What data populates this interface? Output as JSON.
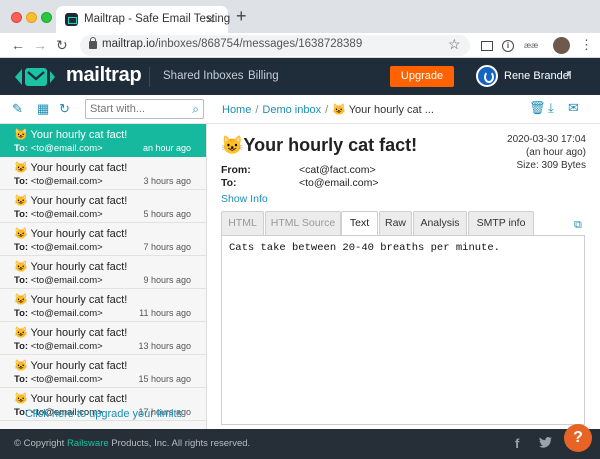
{
  "browser": {
    "tab_title": "Mailtrap - Safe Email Testing",
    "tab_close": "×",
    "new_tab": "+",
    "url_host": "mailtrap.io",
    "url_path": "/inboxes/868754/messages/1638728389",
    "translate_label": "ææ"
  },
  "header": {
    "logo": "mailtrap",
    "nav": [
      "Shared Inboxes",
      "Billing"
    ],
    "upgrade_label": "Upgrade",
    "user_name": "Rene Brandel"
  },
  "subbar": {
    "search_placeholder": "Start with...",
    "breadcrumb": [
      "Home",
      "Demo inbox",
      "😺 Your hourly cat ..."
    ]
  },
  "messages": [
    {
      "subject": "😺 Your hourly cat fact!",
      "to_label": "To:",
      "to": "<to@email.com>",
      "time": "an hour ago",
      "active": true
    },
    {
      "subject": "😺 Your hourly cat fact!",
      "to_label": "To:",
      "to": "<to@email.com>",
      "time": "3 hours ago"
    },
    {
      "subject": "😺 Your hourly cat fact!",
      "to_label": "To:",
      "to": "<to@email.com>",
      "time": "5 hours ago"
    },
    {
      "subject": "😺 Your hourly cat fact!",
      "to_label": "To:",
      "to": "<to@email.com>",
      "time": "7 hours ago"
    },
    {
      "subject": "😺 Your hourly cat fact!",
      "to_label": "To:",
      "to": "<to@email.com>",
      "time": "9 hours ago"
    },
    {
      "subject": "😺 Your hourly cat fact!",
      "to_label": "To:",
      "to": "<to@email.com>",
      "time": "11 hours ago"
    },
    {
      "subject": "😺 Your hourly cat fact!",
      "to_label": "To:",
      "to": "<to@email.com>",
      "time": "13 hours ago"
    },
    {
      "subject": "😺 Your hourly cat fact!",
      "to_label": "To:",
      "to": "<to@email.com>",
      "time": "15 hours ago"
    },
    {
      "subject": "😺 Your hourly cat fact!",
      "to_label": "To:",
      "to": "<to@email.com>",
      "time": "17 hours ago"
    }
  ],
  "sidebar": {
    "upgrade_link": "Click here to upgrade your limits"
  },
  "message": {
    "title": "😺Your hourly cat fact!",
    "date": "2020-03-30 17:04",
    "relative_date": "(an hour ago)",
    "size": "Size: 309 Bytes",
    "from_label": "From:",
    "from": "<cat@fact.com>",
    "to_label": "To:",
    "to": "<to@email.com>",
    "show_info": "Show Info",
    "tabs": [
      "HTML",
      "HTML Source",
      "Text",
      "Raw",
      "Analysis",
      "SMTP info"
    ],
    "active_tab": "Text",
    "body": "Cats take between 20-40 breaths per minute."
  },
  "footer": {
    "copyright_prefix": "© Copyright ",
    "copyright_brand": "Railsware",
    "copyright_suffix": " Products, Inc. All rights reserved.",
    "facebook": "f",
    "help": "?"
  },
  "colors": {
    "accent": "#16b89e",
    "header": "#1f2d3b",
    "upgrade": "#ff6200",
    "link": "#1b8fb5",
    "footer": "#262f38",
    "help": "#e76426"
  }
}
